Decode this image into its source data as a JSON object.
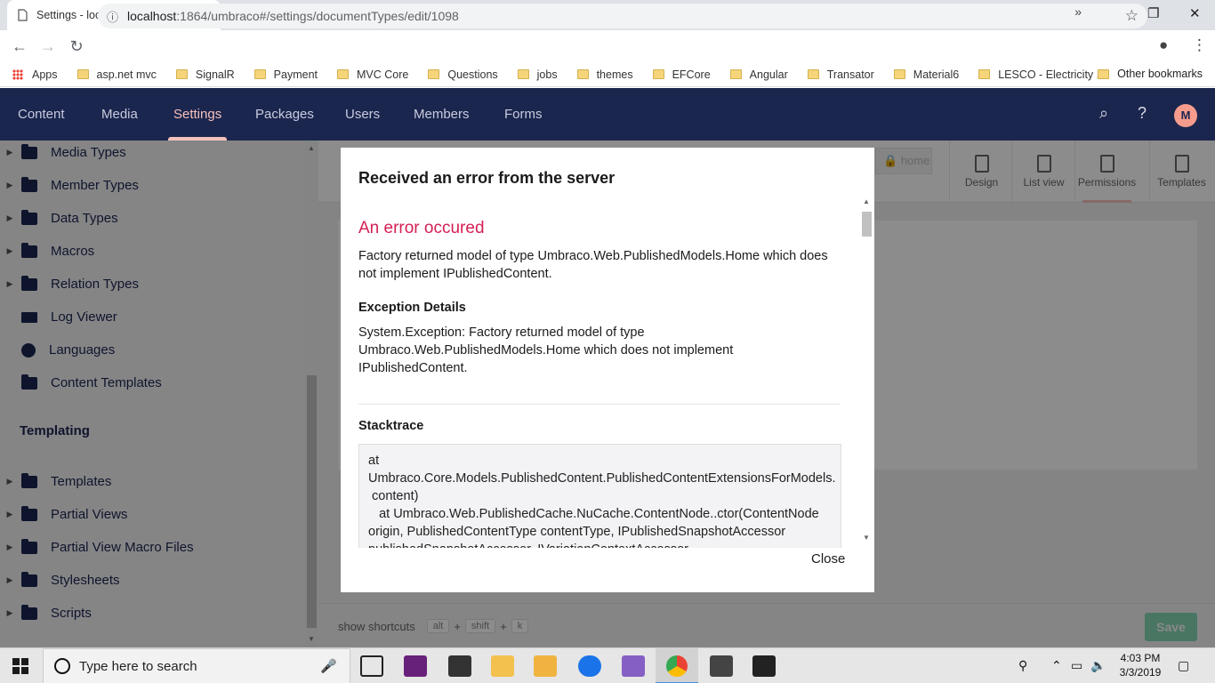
{
  "browser": {
    "tab_title": "Settings - localhost",
    "url_host": "localhost",
    "url_path": ":1864/umbraco#/settings/documentTypes/edit/1098",
    "bookmarks": [
      "Apps",
      "asp.net mvc",
      "SignalR",
      "Payment",
      "MVC Core",
      "Questions",
      "jobs",
      "themes",
      "EFCore",
      "Angular",
      "Transator",
      "Material6",
      "LESCO - Electricity ..."
    ],
    "other_bookmarks": "Other bookmarks"
  },
  "header": {
    "sections": [
      "Content",
      "Media",
      "Settings",
      "Packages",
      "Users",
      "Members",
      "Forms"
    ],
    "active_section": "Settings",
    "avatar_initial": "M",
    "accent_color": "#f5c1bc",
    "brand_color": "#1b264f"
  },
  "tree": {
    "settings_items": [
      "Media Types",
      "Member Types",
      "Data Types",
      "Macros",
      "Relation Types",
      "Log Viewer",
      "Languages",
      "Content Templates"
    ],
    "templating_title": "Templating",
    "templating_items": [
      "Templates",
      "Partial Views",
      "Partial View Macro Files",
      "Stylesheets",
      "Scripts"
    ]
  },
  "editor": {
    "alias_placeholder": "home",
    "apps": [
      "Design",
      "List view",
      "Permissions",
      "Templates"
    ],
    "active_app": "Permissions",
    "shortcuts_label": "show shortcuts",
    "shortcut_keys": [
      "alt",
      "shift",
      "k"
    ],
    "save_label": "Save"
  },
  "modal": {
    "title": "Received an error from the server",
    "error_heading": "An error occured",
    "error_message": "Factory returned model of type Umbraco.Web.PublishedModels.Home which does not implement IPublishedContent.",
    "exception_label": "Exception Details",
    "exception_text": "System.Exception: Factory returned model of type Umbraco.Web.PublishedModels.Home which does not implement IPublishedContent.",
    "stacktrace_label": "Stacktrace",
    "stacktrace_text": "at\nUmbraco.Core.Models.PublishedContent.PublishedContentExtensionsForModels.\n content)\n   at Umbraco.Web.PublishedCache.NuCache.ContentNode..ctor(ContentNode\norigin, PublishedContentType contentType, IPublishedSnapshotAccessor\npublishedSnapshotAccessor, IVariationContextAccessor",
    "close_label": "Close"
  },
  "taskbar": {
    "search_placeholder": "Type here to search",
    "time": "4:03 PM",
    "date": "3/3/2019"
  }
}
